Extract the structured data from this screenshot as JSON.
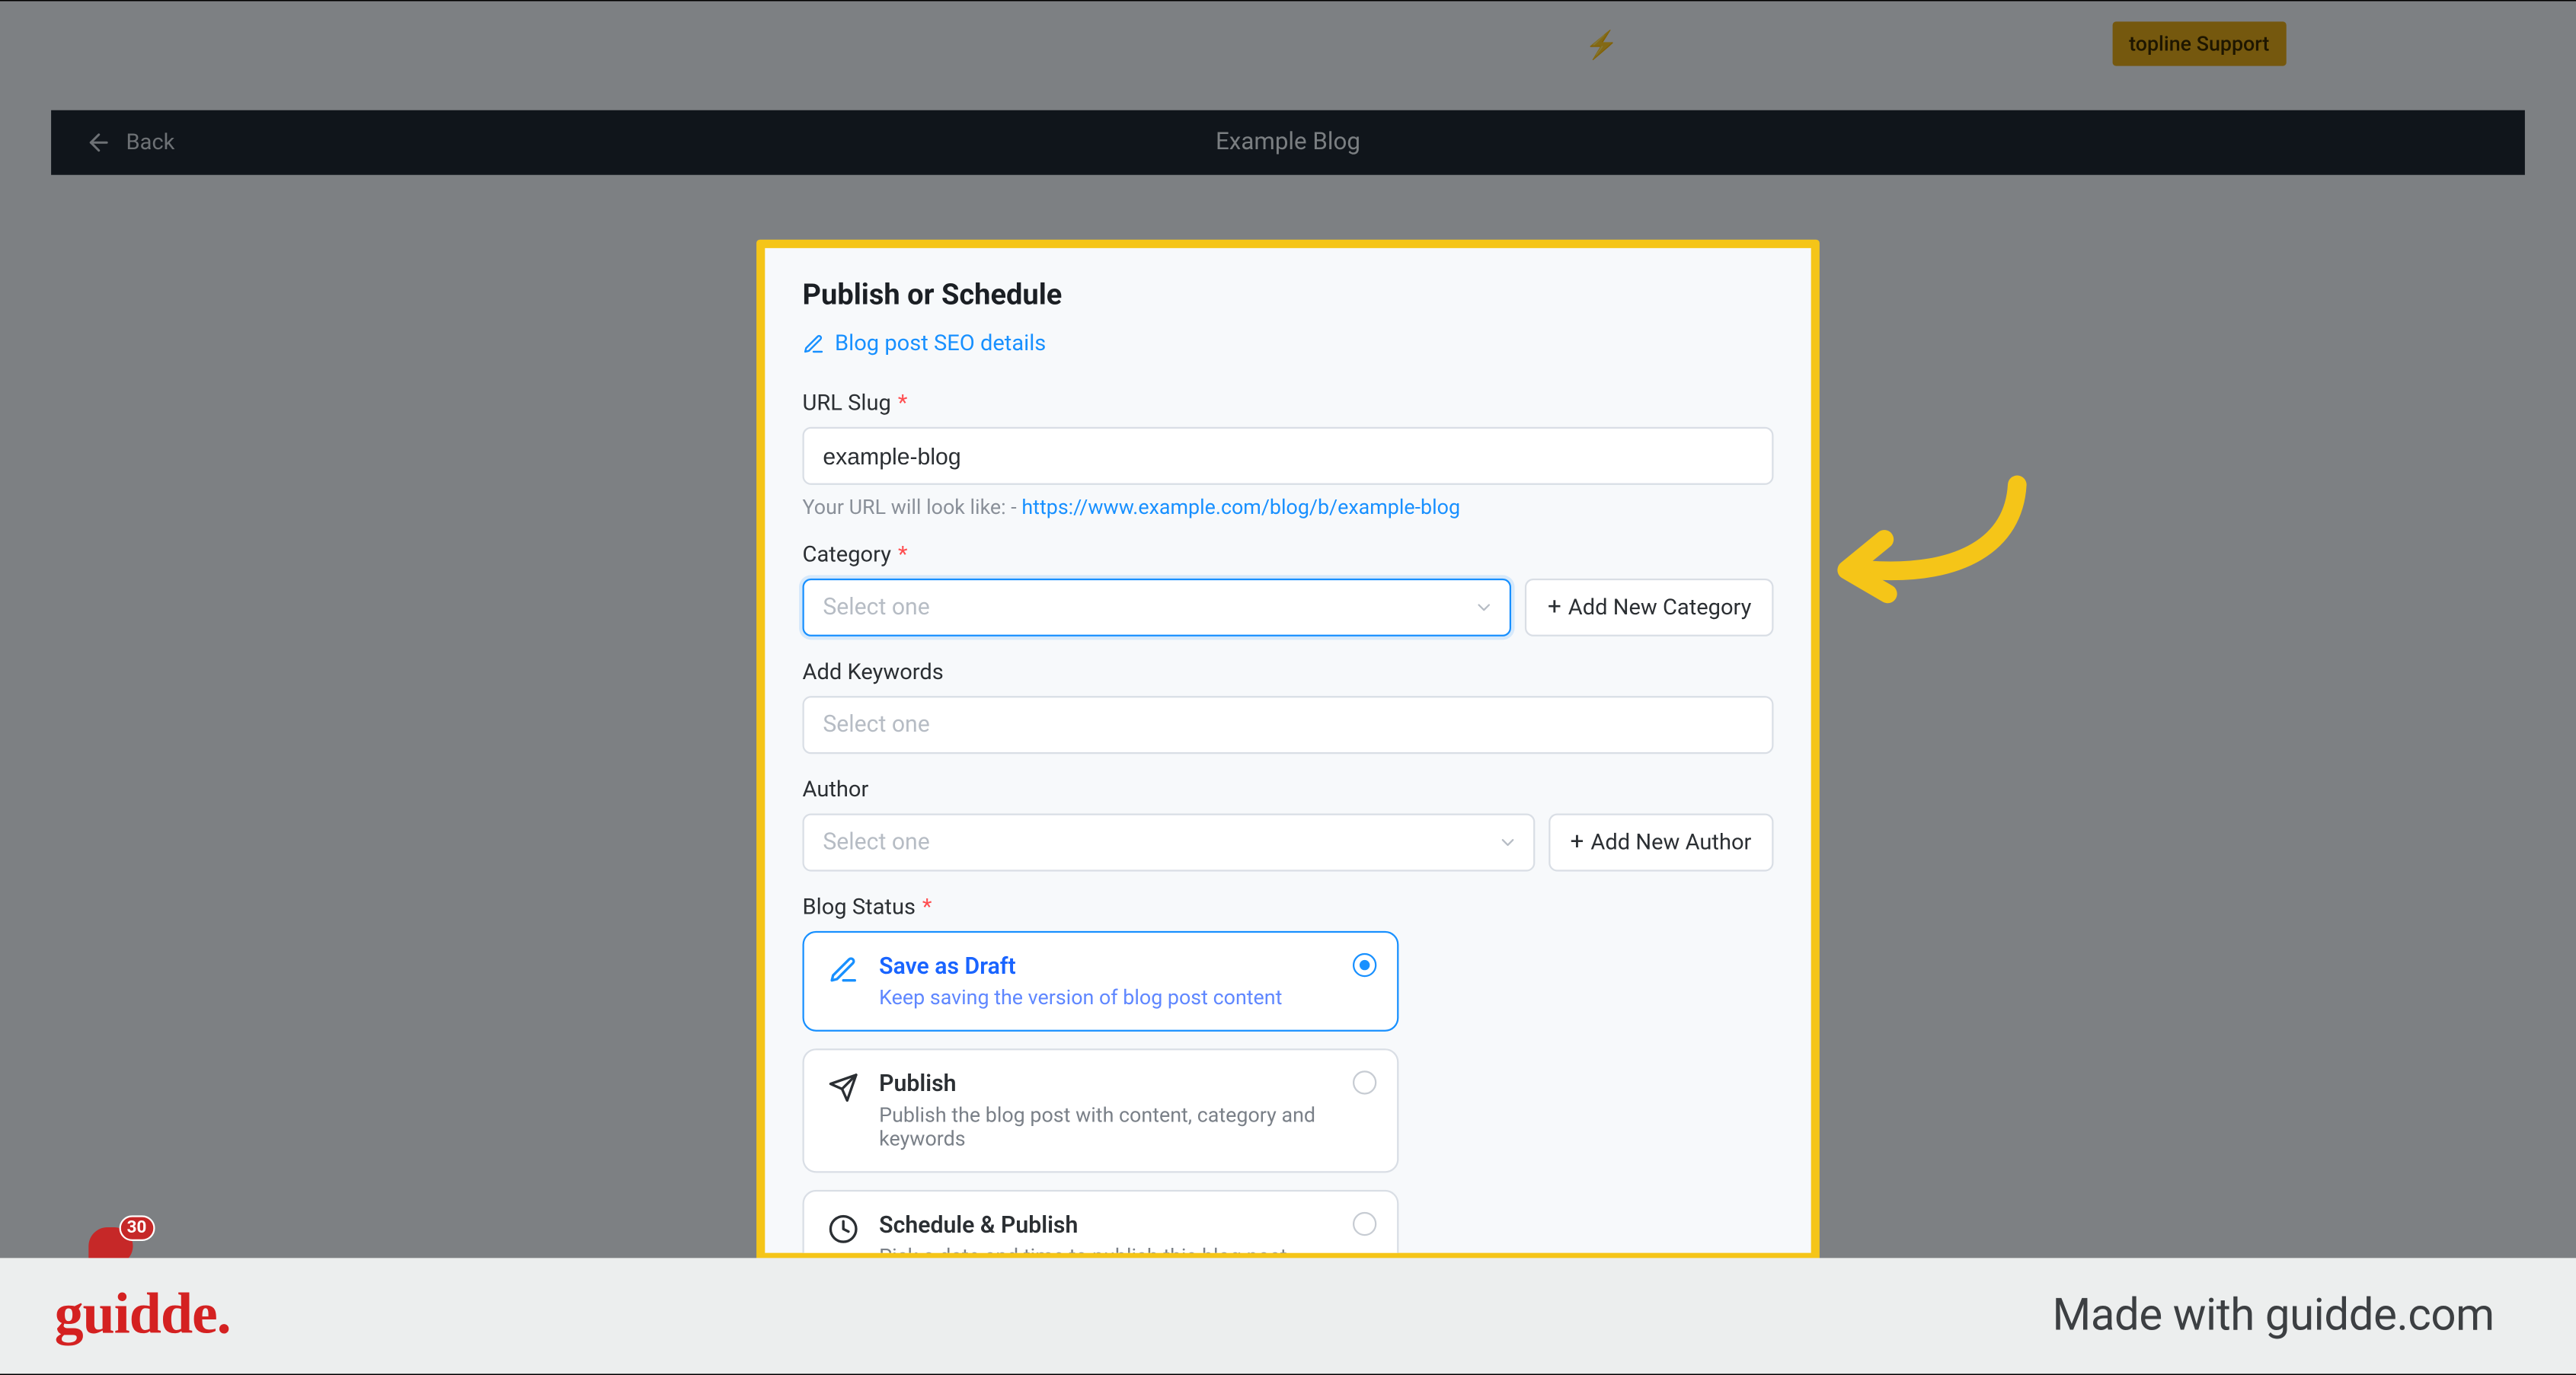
{
  "support_button": "topline Support",
  "back_label": "Back",
  "header_title": "Example Blog",
  "panel": {
    "title": "Publish or Schedule",
    "seo_link": "Blog post SEO details",
    "url_slug": {
      "label": "URL Slug",
      "value": "example-blog",
      "hint_prefix": "Your URL will look like: - ",
      "hint_link": "https://www.example.com/blog/b/example-blog"
    },
    "category": {
      "label": "Category",
      "placeholder": "Select one",
      "add_button": "Add New Category"
    },
    "keywords": {
      "label": "Add Keywords",
      "placeholder": "Select one"
    },
    "author": {
      "label": "Author",
      "placeholder": "Select one",
      "add_button": "Add New Author"
    },
    "status": {
      "label": "Blog Status",
      "options": [
        {
          "title": "Save as Draft",
          "desc": "Keep saving the version of blog post content"
        },
        {
          "title": "Publish",
          "desc": "Publish the blog post with content, category and keywords"
        },
        {
          "title": "Schedule & Publish",
          "desc": "Pick a date and time to publish this blog post"
        }
      ]
    }
  },
  "notification_count": "30",
  "ribbon": {
    "brand": "guidde.",
    "madewith": "Made with guidde.com"
  },
  "colors": {
    "highlight": "#f5c518",
    "primary": "#1890ff",
    "danger": "#d42121"
  }
}
